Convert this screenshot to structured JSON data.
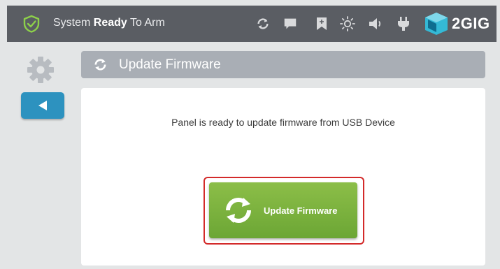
{
  "status_bar": {
    "status_prefix": "System ",
    "status_bold": "Ready",
    "status_suffix": " To Arm",
    "icons": [
      "shield-check-icon",
      "sync-icon",
      "message-icon",
      "bookmark-icon",
      "brightness-icon",
      "volume-icon",
      "power-plug-icon"
    ],
    "brand": "2GIG"
  },
  "sidebar": {
    "icons": [
      "gear-icon",
      "back-arrow-icon"
    ]
  },
  "header": {
    "title": "Update Firmware",
    "icon": "sync-icon"
  },
  "content": {
    "message": "Panel is ready to update firmware from USB Device",
    "button_label": "Update Firmware",
    "button_icon": "sync-icon"
  },
  "colors": {
    "topbar": "#5a5d63",
    "header": "#a9aeb5",
    "accent_green": "#7ab33f",
    "back_button": "#2d92bf",
    "shield_green": "#8dd04a",
    "highlight": "#d32a2a"
  }
}
